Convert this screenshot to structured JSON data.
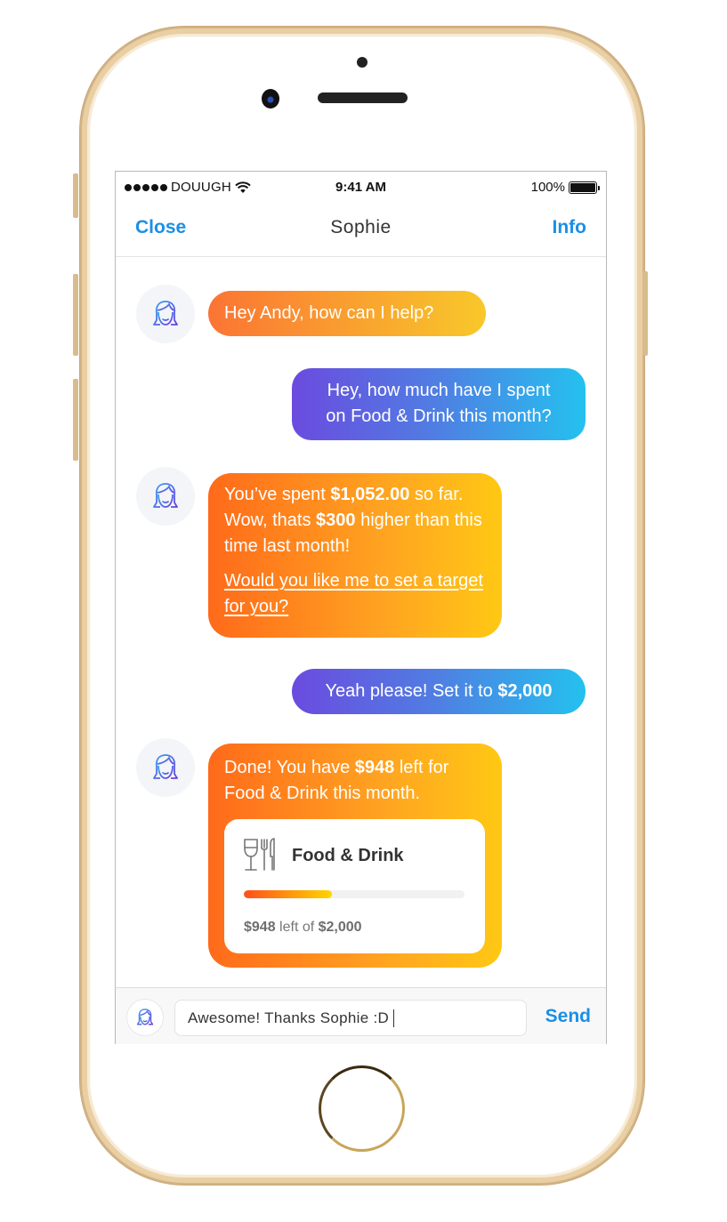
{
  "status_bar": {
    "carrier": "DOUUGH",
    "time": "9:41 AM",
    "battery_percent": "100%",
    "signal_icon": "signal-dots-icon",
    "wifi_icon": "wifi-icon",
    "battery_icon": "battery-icon"
  },
  "nav": {
    "close_label": "Close",
    "title": "Sophie",
    "info_label": "Info"
  },
  "colors": {
    "accent": "#1b8fe6",
    "bot_gradient": [
      "#ff6a1a",
      "#ffc814"
    ],
    "user_gradient": [
      "#6b4bdf",
      "#24c1ef"
    ],
    "avatar_bg": "#f3f5f9"
  },
  "messages": [
    {
      "sender": "bot",
      "avatar_icon": "sophie-face-icon",
      "text": "Hey Andy, how can I help?"
    },
    {
      "sender": "user",
      "line1": "Hey, how much have I spent",
      "line2": "on Food & Drink this month?"
    },
    {
      "sender": "bot",
      "avatar_icon": "sophie-face-icon",
      "p1_a": "You’ve spent ",
      "p1_amount": "$1,052.00",
      "p1_b": " so far. Wow, thats ",
      "p1_diff": "$300",
      "p1_c": " higher than this time last month!",
      "link": "Would you like me to set a target for you?"
    },
    {
      "sender": "user",
      "text": "Yeah please! Set it to ",
      "amount": "$2,000"
    },
    {
      "sender": "bot",
      "avatar_icon": "sophie-face-icon",
      "t_a": "Done! You have ",
      "t_amount": "$948",
      "t_b": " left for Food & Drink this month.",
      "card": {
        "icon": "wine-glass-cutlery-icon",
        "title": "Food & Drink",
        "progress_fraction": 0.4,
        "left_amount": "$948",
        "left_label": " left of ",
        "total_amount": "$2,000"
      }
    }
  ],
  "composer": {
    "avatar_icon": "sophie-face-icon",
    "input_value": "Awesome! Thanks Sophie :D",
    "send_label": "Send"
  }
}
